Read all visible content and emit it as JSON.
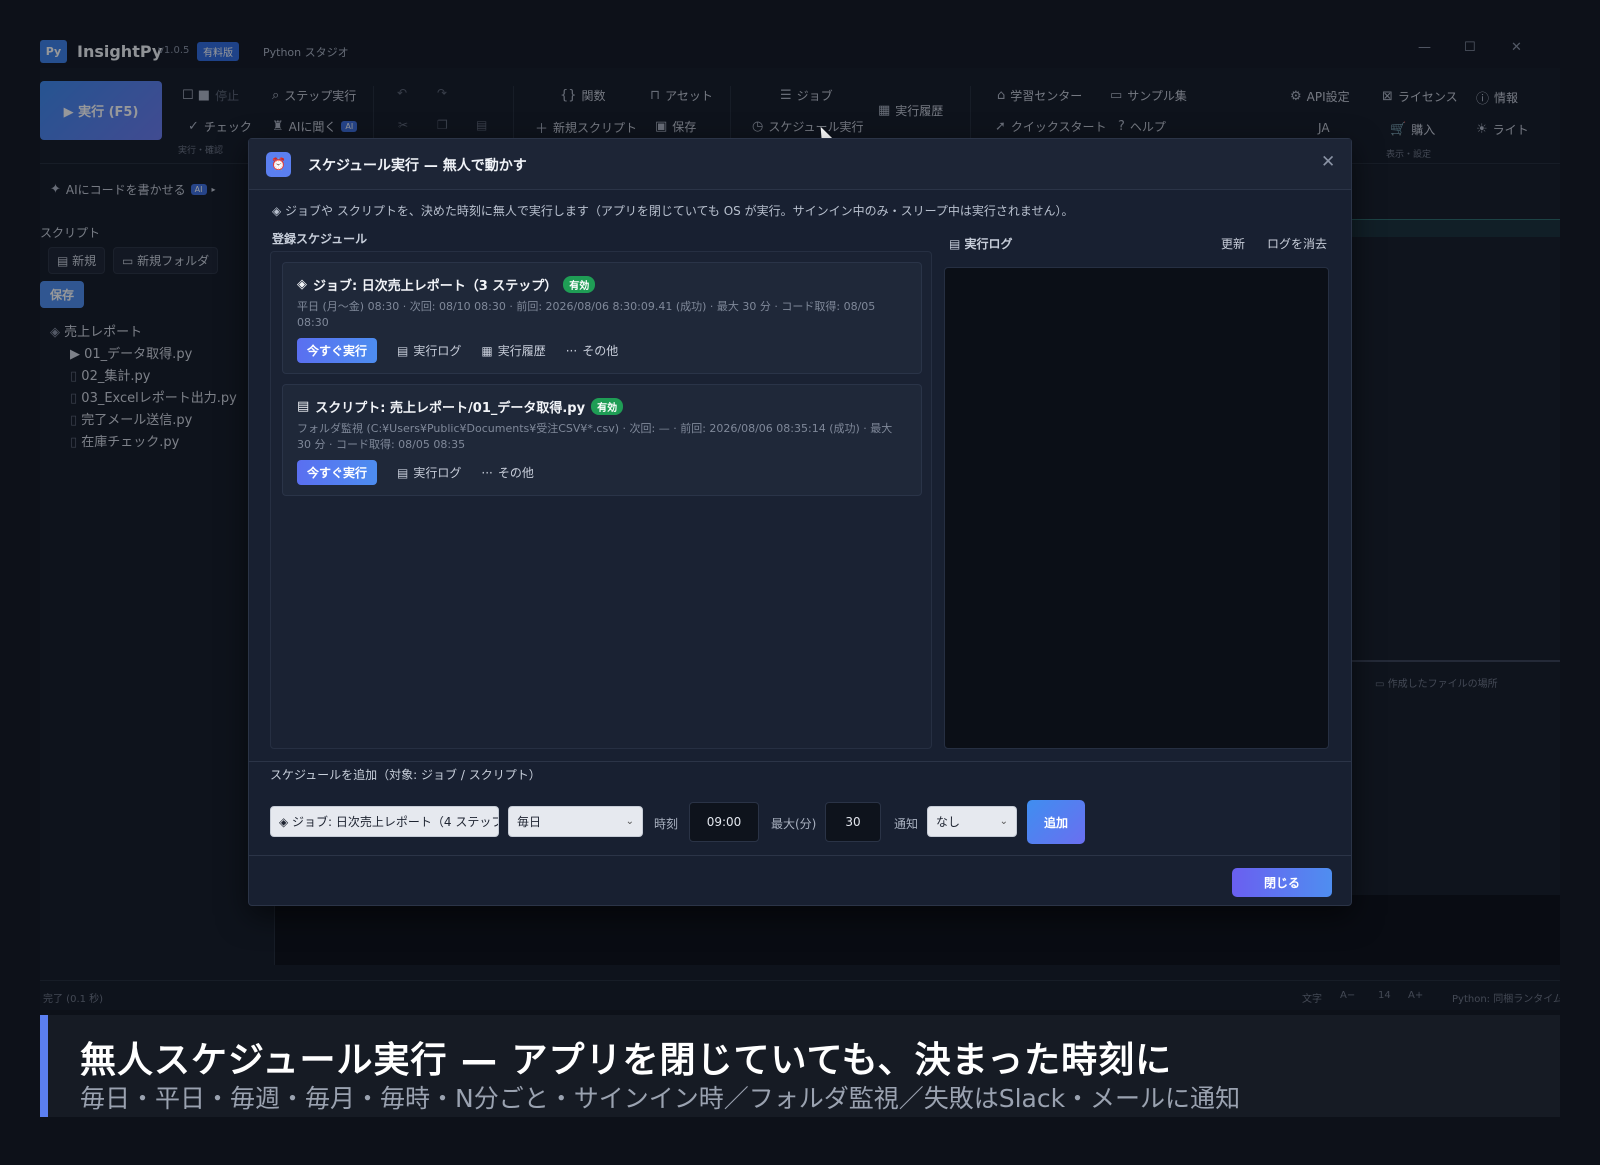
{
  "app": {
    "logo": "Py",
    "title": "InsightPy",
    "version": "v1.0.5",
    "edition": "有料版",
    "subtitle": "Python スタジオ",
    "win_minimize": "—",
    "win_maximize": "☐",
    "win_close": "✕"
  },
  "ribbon": {
    "run": "▶ 実行 (F5)",
    "stop": "停止",
    "check": "チェック",
    "group_run": "実行・確認",
    "step_run": "ステップ実行",
    "ask_ai": "AIに聞く",
    "ai_tag": "AI",
    "functions": "関数",
    "assets": "アセット",
    "new_script": "新規スクリプト",
    "save": "保存",
    "jobs": "ジョブ",
    "schedule_run": "スケジュール実行",
    "run_history": "実行履歴",
    "learning_center": "学習センター",
    "quickstart": "クイックスタート",
    "samples": "サンプル集",
    "help": "ヘルプ",
    "api_settings": "API設定",
    "license": "ライセンス",
    "info": "情報",
    "lang": "JA",
    "purchase": "購入",
    "light": "ライト",
    "group_view": "表示・設定"
  },
  "sidebar": {
    "ai_write": "AIにコードを書かせる",
    "ai_tag": "AI",
    "section": "スクリプト",
    "new": "新規",
    "new_folder": "新規フォルダ",
    "save": "保存",
    "folder": "売上レポート",
    "files": [
      "01_データ取得.py",
      "02_集計.py",
      "03_Excelレポート出力.py",
      "完了メール送信.py",
      "在庫チェック.py"
    ]
  },
  "editor": {
    "created_files": "作成したファイルの場所"
  },
  "statusbar": {
    "left": "完了 (0.1 秒)",
    "font": "文字",
    "dec": "A−",
    "size": "14",
    "inc": "A+",
    "runtime": "Python: 同梱ランタイム"
  },
  "dialog": {
    "title": "スケジュール実行 — 無人で動かす",
    "description": "ジョブや スクリプトを、決めた時刻に無人で実行します（アプリを閉じていても OS が実行。サインイン中のみ・スリープ中は実行されません）。",
    "registered": "登録スケジュール",
    "log_title": "実行ログ",
    "refresh": "更新",
    "clear_log": "ログを消去",
    "cards": [
      {
        "title": "ジョブ: 日次売上レポート（3 ステップ）",
        "badge": "有効",
        "meta": "平日 (月〜金) 08:30 · 次回: 08/10 08:30 · 前回: 2026/08/06 8:30:09.41 (成功) · 最大 30 分 · コード取得: 08/05 08:30",
        "run_now": "今すぐ実行",
        "log": "実行ログ",
        "history": "実行履歴",
        "more": "その他"
      },
      {
        "title": "スクリプト: 売上レポート/01_データ取得.py",
        "badge": "有効",
        "meta": "フォルダ監視 (C:¥Users¥Public¥Documents¥受注CSV¥*.csv) · 次回: — · 前回: 2026/08/06 08:35:14 (成功) · 最大 30 分 · コード取得: 08/05 08:35",
        "run_now": "今すぐ実行",
        "log": "実行ログ",
        "more": "その他"
      }
    ],
    "add": {
      "label": "スケジュールを追加（対象: ジョブ / スクリプト）",
      "target": "ジョブ: 日次売上レポート（4 ステップ",
      "frequency": "毎日",
      "time_label": "時刻",
      "time": "09:00",
      "max_label": "最大(分)",
      "max": "30",
      "notify_label": "通知",
      "notify": "なし",
      "add_button": "追加"
    },
    "close": "閉じる"
  },
  "caption": {
    "main": "無人スケジュール実行 — アプリを閉じていても、決まった時刻に",
    "sub": "毎日・平日・毎週・毎月・毎時・N分ごと・サインイン時／フォルダ監視／失敗はSlack・メールに通知"
  }
}
